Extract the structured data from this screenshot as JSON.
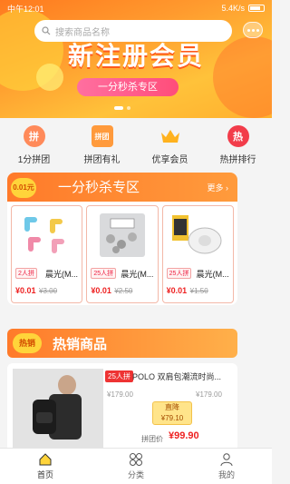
{
  "status": {
    "time": "中午12:01",
    "right": "5.4K/s"
  },
  "search": {
    "placeholder": "搜索商品名称"
  },
  "banner": {
    "title": "新注册会员",
    "pill": "一分秒杀专区"
  },
  "categories": [
    {
      "label": "1分拼团",
      "icon": "拼"
    },
    {
      "label": "拼团有礼",
      "icon": "拼团"
    },
    {
      "label": "优享会员",
      "icon": "crown"
    },
    {
      "label": "热拼排行",
      "icon": "热"
    }
  ],
  "flash": {
    "tag": "0.01元",
    "title": "一分秒杀专区",
    "more": "更多 ›",
    "items": [
      {
        "badge": "2人拼",
        "name": "晨光(M...",
        "price": "¥0.01",
        "orig": "¥3.00"
      },
      {
        "badge": "25人拼",
        "name": "晨光(M...",
        "price": "¥0.01",
        "orig": "¥2.50"
      },
      {
        "badge": "25人拼",
        "name": "晨光(M...",
        "price": "¥0.01",
        "orig": "¥1.50"
      }
    ]
  },
  "hot": {
    "tag": "热销",
    "title": "热销商品"
  },
  "product": {
    "badge": "25人拼",
    "name": "POLO 双肩包潮流时尚...",
    "orig1": "¥179.00",
    "orig2": "¥179.00",
    "drop_label": "直降",
    "drop_value": "¥79.10",
    "group_label": "拼团价",
    "group_price": "¥99.90"
  },
  "tabbar": [
    {
      "label": "首页"
    },
    {
      "label": "分类"
    },
    {
      "label": "我的"
    }
  ],
  "colors": {
    "accent": "#ff7a2a",
    "price": "#e22222"
  }
}
